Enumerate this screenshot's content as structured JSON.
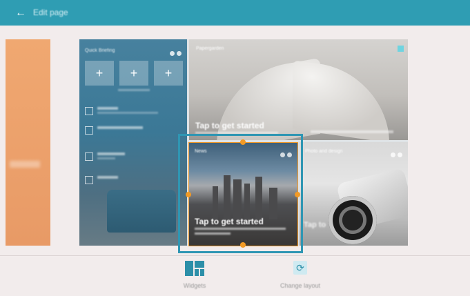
{
  "appbar": {
    "back_icon": "arrow-left-icon",
    "title": "Edit page"
  },
  "panels": {
    "briefing": {
      "title": "Quick Briefing",
      "tile_symbol": "+"
    },
    "paper": {
      "title": "Papergarden",
      "tap_text": "Tap to get started"
    },
    "news": {
      "title": "News",
      "tap_text": "Tap to get started"
    },
    "photo": {
      "title": "Photo and design",
      "tap_text": "Tap to"
    }
  },
  "bottom": {
    "widgets_label": "Widgets",
    "change_layout_label": "Change layout",
    "change_layout_glyph": "⟳"
  },
  "colors": {
    "appbar": "#2f9db3",
    "selection_outer": "#2f96b3",
    "selection_handles": "#f29a25"
  }
}
